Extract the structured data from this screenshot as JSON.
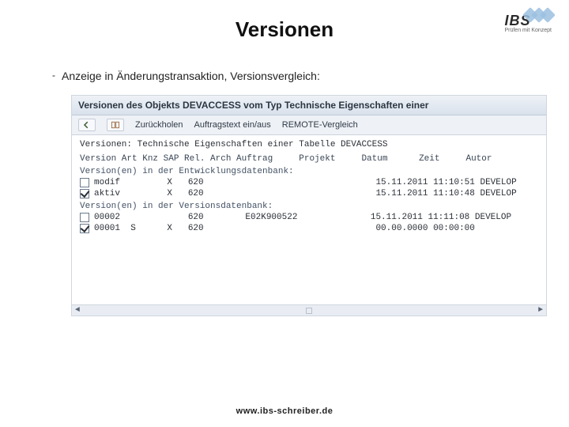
{
  "slide": {
    "title": "Versionen",
    "bullet": "Anzeige in Änderungstransaktion, Versionsvergleich:",
    "footer": "www.ibs-schreiber.de"
  },
  "logo": {
    "brand": "IBS",
    "subtitle": "Prüfen mit Konzept"
  },
  "sap": {
    "window_title": "Versionen des Objekts DEVACCESS vom Typ Technische Eigenschaften einer",
    "toolbar": {
      "back_icon": "back-arrow",
      "retrieve_label": "Zurückholen",
      "ordertext_label": "Auftragstext ein/aus",
      "remote_label": "REMOTE-Vergleich"
    },
    "descriptor": "Versionen: Technische Eigenschaften einer Tabelle DEVACCESS",
    "columns": "Version Art Knz SAP Rel. Arch Auftrag     Projekt     Datum      Zeit     Autor",
    "section_dev": "Version(en) in der Entwicklungsdatenbank:",
    "rows_dev": [
      {
        "checked": false,
        "text": "modif         X   620                                 15.11.2011 11:10:51 DEVELOP"
      },
      {
        "checked": true,
        "text": "aktiv         X   620                                 15.11.2011 11:10:48 DEVELOP"
      }
    ],
    "section_ver": "Version(en) in der Versionsdatenbank:",
    "rows_ver": [
      {
        "checked": false,
        "text": "00002             620        E02K900522              15.11.2011 11:11:08 DEVELOP"
      },
      {
        "checked": true,
        "text": "00001  S      X   620                                 00.00.0000 00:00:00"
      }
    ]
  }
}
